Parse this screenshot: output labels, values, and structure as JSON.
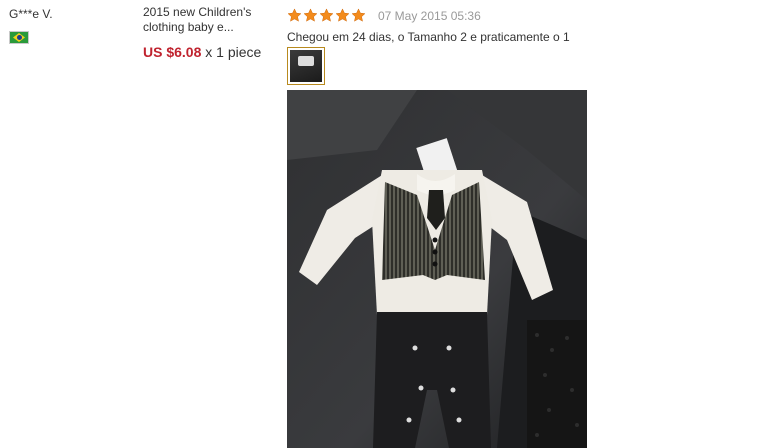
{
  "buyer": {
    "name": "G***e V.",
    "country_flag": "brazil-flag-icon"
  },
  "product": {
    "title": "2015 new Children's clothing baby e...",
    "price": "US $6.08",
    "quantity": "x 1 piece"
  },
  "feedback": {
    "rating": 5,
    "rating_max": 5,
    "star_color": "#f38b1c",
    "date": "07 May 2015 05:36",
    "text": "Chegou em 24 dias, o Tamanho 2 e praticamente o 1",
    "thumbnail_icon": "review-photo-thumbnail",
    "photo_icon": "baby-suit-photo"
  },
  "colors": {
    "price": "#c0232f",
    "date": "#999999",
    "text": "#333333"
  }
}
